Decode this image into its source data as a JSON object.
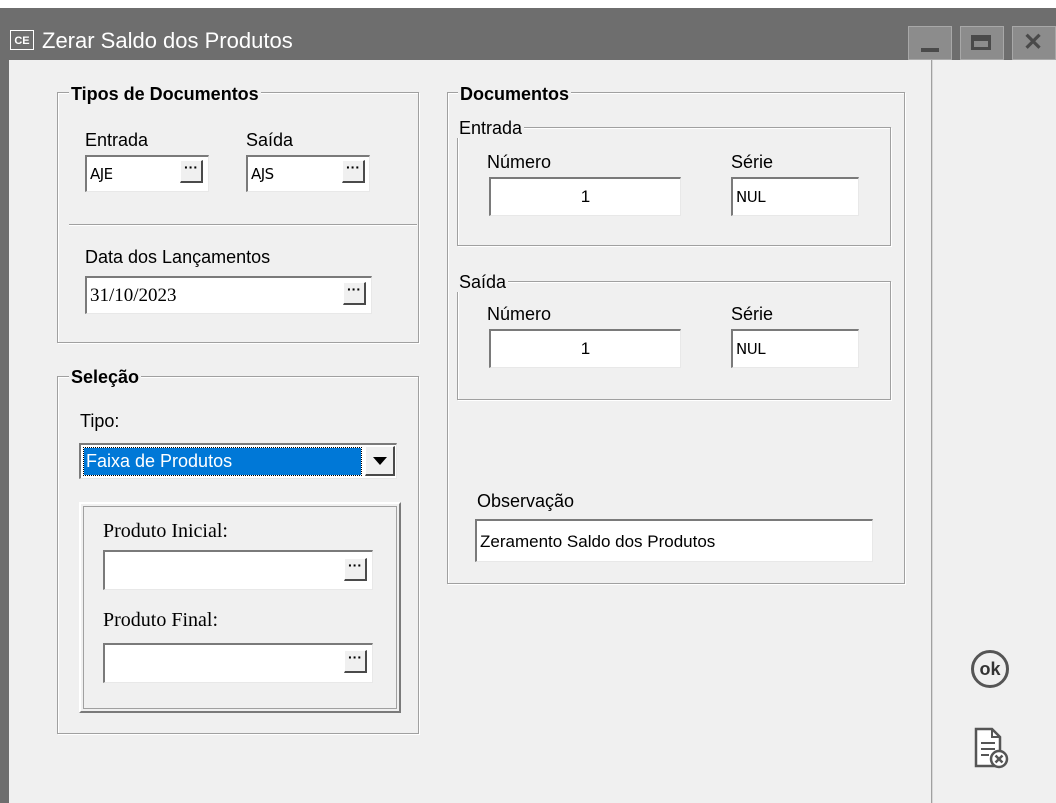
{
  "window": {
    "title": "Zerar Saldo dos Produtos",
    "icon_text": "CE",
    "icon": "ce-app-icon"
  },
  "tipos_documentos": {
    "title": "Tipos de Documentos",
    "entrada_label": "Entrada",
    "entrada_value": "AJE",
    "saida_label": "Saída",
    "saida_value": "AJS",
    "data_label": "Data dos Lançamentos",
    "data_value": "31/10/2023"
  },
  "selecao": {
    "title": "Seleção",
    "tipo_label": "Tipo:",
    "tipo_value": "Faixa de Produtos",
    "produto_inicial_label": "Produto Inicial:",
    "produto_inicial_value": "",
    "produto_final_label": "Produto Final:",
    "produto_final_value": ""
  },
  "documentos": {
    "title": "Documentos",
    "entrada": {
      "title": "Entrada",
      "numero_label": "Número",
      "numero_value": "1",
      "serie_label": "Série",
      "serie_value": "NUL"
    },
    "saida": {
      "title": "Saída",
      "numero_label": "Número",
      "numero_value": "1",
      "serie_label": "Série",
      "serie_value": "NUL"
    },
    "observacao_label": "Observação",
    "observacao_value": "Zeramento Saldo dos Produtos"
  },
  "buttons": {
    "ellipsis": "···",
    "ok_text": "ok",
    "ok_icon": "ok-icon",
    "cancel_icon": "cancel-document-icon"
  }
}
